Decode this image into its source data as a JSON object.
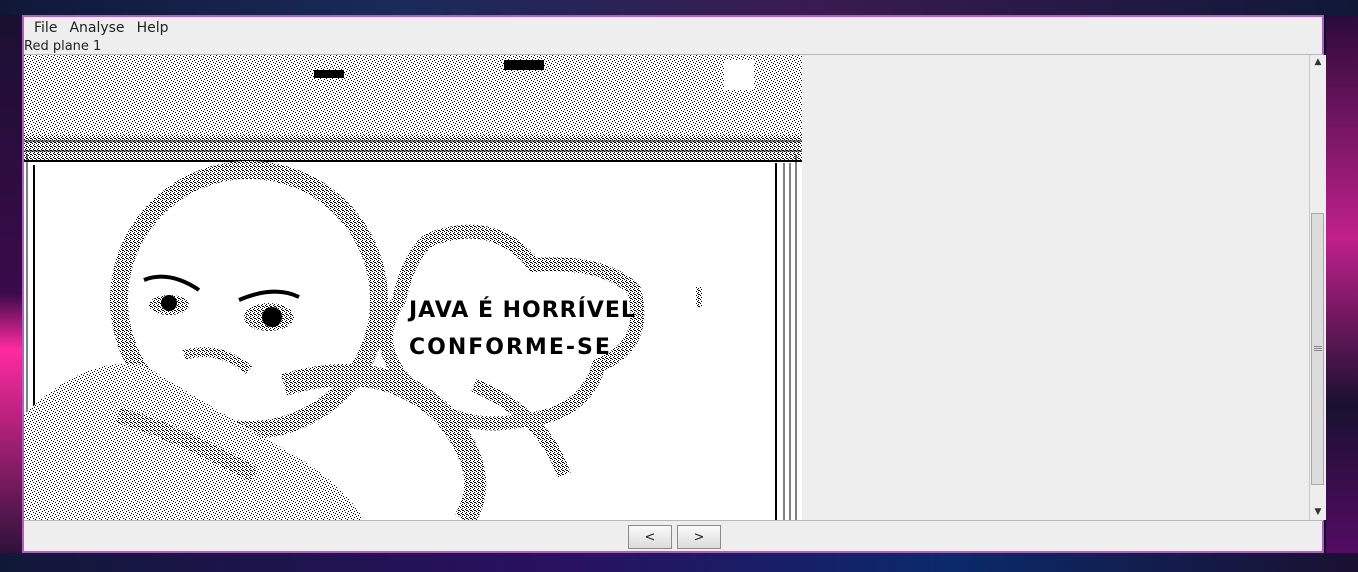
{
  "menu": {
    "file": "File",
    "analyse": "Analyse",
    "help": "Help"
  },
  "status": {
    "plane_label": "Red plane 1"
  },
  "image": {
    "caption_line1": "JAVA É HORRÍVEL",
    "caption_line2": "CONFORME-SE"
  },
  "navigation": {
    "prev_label": "<",
    "next_label": ">"
  },
  "colors": {
    "window_border": "#b35cc4",
    "window_bg": "#eeeeee"
  }
}
